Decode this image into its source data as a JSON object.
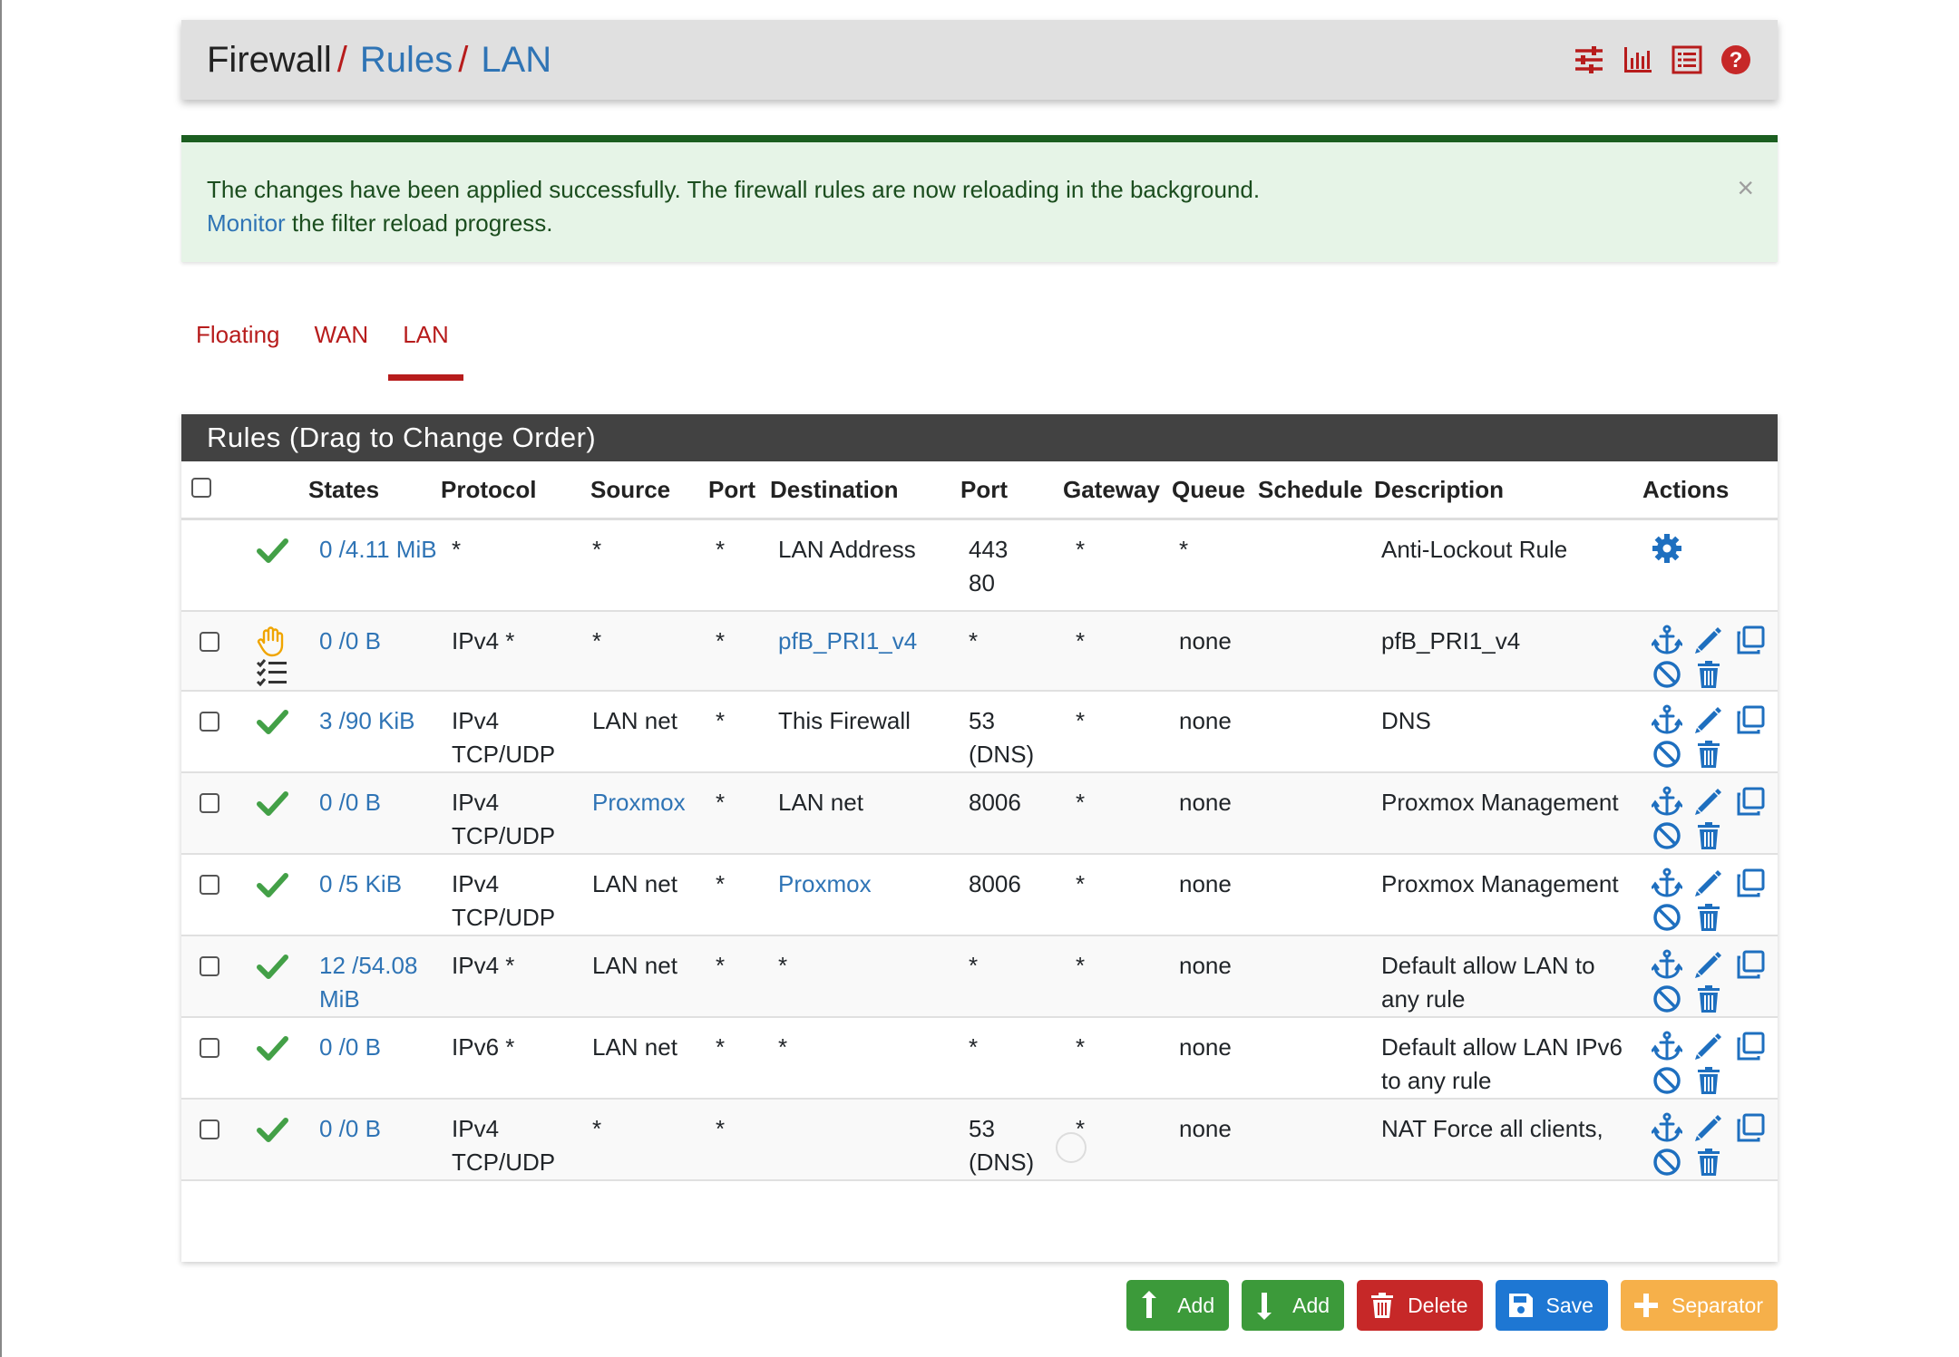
{
  "breadcrumb": {
    "root": "Firewall",
    "sep": "/",
    "rules": "Rules",
    "current": "LAN"
  },
  "header_icons": [
    "sliders-icon",
    "bar-chart-icon",
    "list-icon",
    "help-icon"
  ],
  "alert": {
    "message": "The changes have been applied successfully. The firewall rules are now reloading in the background.",
    "link_text": "Monitor",
    "trailing_text": " the filter reload progress.",
    "close": "×"
  },
  "tabs": [
    {
      "label": "Floating"
    },
    {
      "label": "WAN"
    },
    {
      "label": "LAN",
      "active": true
    }
  ],
  "panel": {
    "title": "Rules (Drag to Change Order)"
  },
  "columns": {
    "states": "States",
    "protocol": "Protocol",
    "source": "Source",
    "port": "Port",
    "destination": "Destination",
    "dport": "Port",
    "gateway": "Gateway",
    "queue": "Queue",
    "schedule": "Schedule",
    "description": "Description",
    "actions": "Actions"
  },
  "rows": [
    {
      "status": "pass",
      "states": "0 /4.11 MiB",
      "protocol": "*",
      "source": "*",
      "sport": "*",
      "destination": "LAN Address",
      "dport": "443 80",
      "gateway": "*",
      "queue": "*",
      "schedule": "",
      "description": "Anti-Lockout Rule"
    },
    {
      "status": "match",
      "states": "0 /0 B",
      "protocol": "IPv4 *",
      "source": "*",
      "sport": "*",
      "destination": "pfB_PRI1_v4",
      "dport": "*",
      "gateway": "*",
      "queue": "none",
      "schedule": "",
      "description": "pfB_PRI1_v4"
    },
    {
      "status": "pass",
      "states": "3 /90 KiB",
      "protocol": "IPv4 TCP/UDP",
      "source": "LAN net",
      "sport": "*",
      "destination": "This Firewall",
      "dport": "53 (DNS)",
      "gateway": "*",
      "queue": "none",
      "schedule": "",
      "description": "DNS"
    },
    {
      "status": "pass",
      "states": "0 /0 B",
      "protocol": "IPv4 TCP/UDP",
      "source": "Proxmox",
      "sport": "*",
      "destination": "LAN net",
      "dport": "8006",
      "gateway": "*",
      "queue": "none",
      "schedule": "",
      "description": "Proxmox Management"
    },
    {
      "status": "pass",
      "states": "0 /5 KiB",
      "protocol": "IPv4 TCP/UDP",
      "source": "LAN net",
      "sport": "*",
      "destination": "Proxmox",
      "dport": "8006",
      "gateway": "*",
      "queue": "none",
      "schedule": "",
      "description": "Proxmox Management"
    },
    {
      "status": "pass",
      "states": "12 /54.08 MiB",
      "protocol": "IPv4 *",
      "source": "LAN net",
      "sport": "*",
      "destination": "*",
      "dport": "*",
      "gateway": "*",
      "queue": "none",
      "schedule": "",
      "description": "Default allow LAN to any rule"
    },
    {
      "status": "pass",
      "states": "0 /0 B",
      "protocol": "IPv6 *",
      "source": "LAN net",
      "sport": "*",
      "destination": "*",
      "dport": "*",
      "gateway": "*",
      "queue": "none",
      "schedule": "",
      "description": "Default allow LAN IPv6 to any rule"
    },
    {
      "status": "pass",
      "states": "0 /0 B",
      "protocol": "IPv4 TCP/UDP",
      "source": "*",
      "sport": "*",
      "destination": "",
      "dport": "53 (DNS)",
      "gateway": "*",
      "queue": "none",
      "schedule": "",
      "description": "NAT Force all clients,"
    }
  ],
  "buttons": {
    "add_top": "Add",
    "add_bottom": "Add",
    "delete": "Delete",
    "save": "Save",
    "separator": "Separator"
  },
  "colors": {
    "accent_red": "#b71c1c",
    "link_blue": "#2f74b5",
    "pass_green": "#43a047",
    "success_bar": "#1b5e20"
  }
}
